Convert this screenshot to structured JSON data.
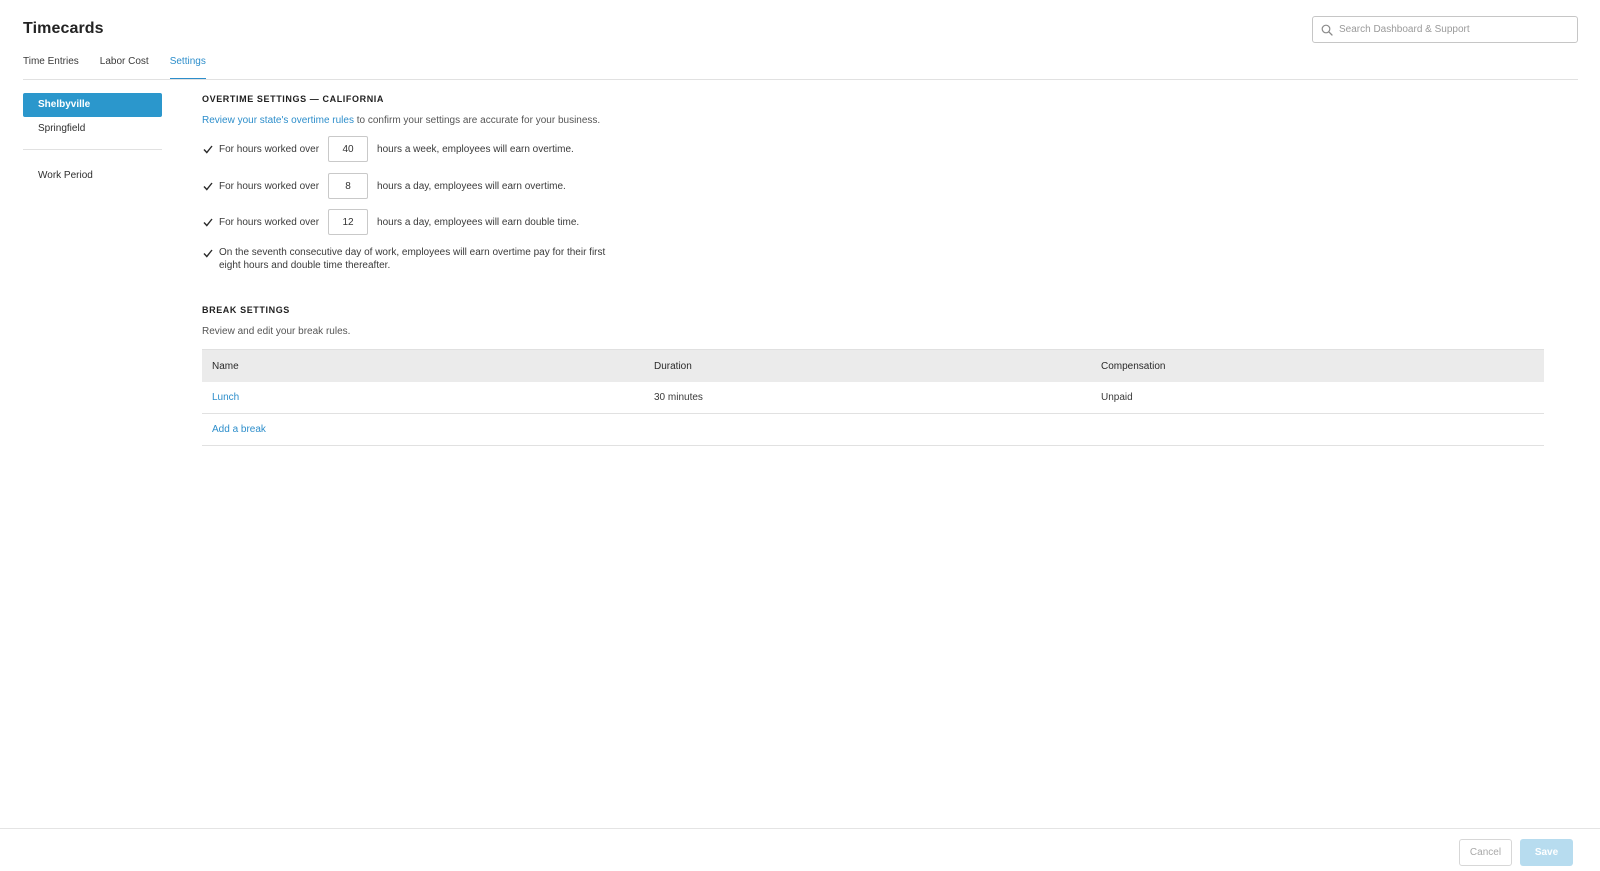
{
  "header": {
    "title": "Timecards",
    "search_placeholder": "Search Dashboard & Support"
  },
  "tabs": [
    {
      "label": "Time Entries",
      "active": false
    },
    {
      "label": "Labor Cost",
      "active": false
    },
    {
      "label": "Settings",
      "active": true
    }
  ],
  "sidebar": {
    "locations": [
      {
        "label": "Shelbyville",
        "selected": true
      },
      {
        "label": "Springfield",
        "selected": false
      }
    ],
    "work_period": "Work Period"
  },
  "overtime": {
    "heading": "OVERTIME SETTINGS — CALIFORNIA",
    "intro_link": "Review your state's overtime rules",
    "intro_rest": " to confirm your settings are accurate for your business.",
    "rules": [
      {
        "checked": true,
        "prefix": "For hours worked over",
        "value": "40",
        "suffix": "hours a week, employees will earn overtime."
      },
      {
        "checked": true,
        "prefix": "For hours worked over",
        "value": "8",
        "suffix": "hours a day, employees will earn overtime."
      },
      {
        "checked": true,
        "prefix": "For hours worked over",
        "value": "12",
        "suffix": "hours a day, employees will earn double time."
      }
    ],
    "seventh_day": {
      "checked": true,
      "line1": "On the seventh consecutive day of work, employees will earn overtime pay for their first",
      "line2": "eight hours and double time thereafter."
    }
  },
  "breaks": {
    "heading": "BREAK SETTINGS",
    "subtitle": "Review and edit your break rules.",
    "columns": [
      "Name",
      "Duration",
      "Compensation"
    ],
    "rows": [
      {
        "name": "Lunch",
        "duration": "30 minutes",
        "compensation": "Unpaid"
      }
    ],
    "add_label": "Add a break"
  },
  "footer": {
    "cancel_label": "Cancel",
    "save_label": "Save"
  },
  "colors": {
    "accent": "#2d8ecb",
    "sidebar_selected": "#2b97cc",
    "save_disabled": "#b7dcef"
  }
}
